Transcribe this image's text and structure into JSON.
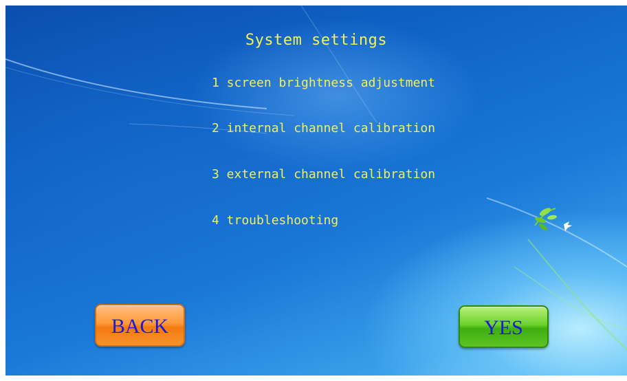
{
  "screen": {
    "title": "System settings",
    "menu": [
      {
        "label": "1 screen brightness adjustment"
      },
      {
        "label": "2 internal channel calibration"
      },
      {
        "label": "3 external channel calibration"
      },
      {
        "label": "4 troubleshooting"
      }
    ],
    "buttons": {
      "back_label": "BACK",
      "yes_label": "YES"
    }
  },
  "colors": {
    "background": "#1466c8",
    "text": "#f0f05a",
    "button_text": "#1a1ad8",
    "back_button": "#f7901e",
    "yes_button": "#4cbc18"
  }
}
